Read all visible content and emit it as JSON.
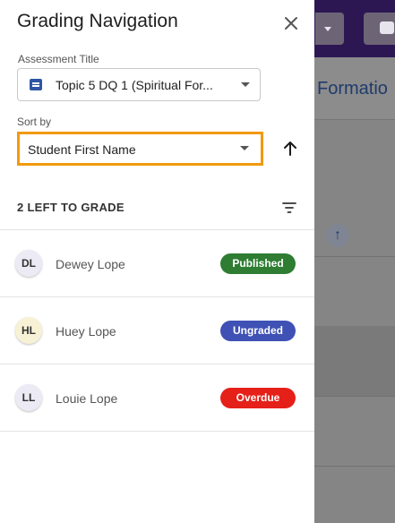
{
  "background": {
    "page_title_partial": "Formatio"
  },
  "drawer": {
    "title": "Grading Navigation",
    "assessment": {
      "label": "Assessment Title",
      "value": "Topic 5 DQ 1 (Spiritual For...",
      "icon": "discussion-icon"
    },
    "sort": {
      "label": "Sort by",
      "value": "Student First Name",
      "direction_icon": "arrow-up-icon"
    },
    "left_to_grade": "2 LEFT TO GRADE",
    "students": [
      {
        "initials": "DL",
        "name": "Dewey Lope",
        "status": "Published",
        "status_color": "#2e7d32"
      },
      {
        "initials": "HL",
        "name": "Huey Lope",
        "status": "Ungraded",
        "status_color": "#3f51b5"
      },
      {
        "initials": "LL",
        "name": "Louie Lope",
        "status": "Overdue",
        "status_color": "#e52019"
      }
    ]
  },
  "colors": {
    "focus_outline": "#f29a0d",
    "topbar": "#2c1753"
  }
}
